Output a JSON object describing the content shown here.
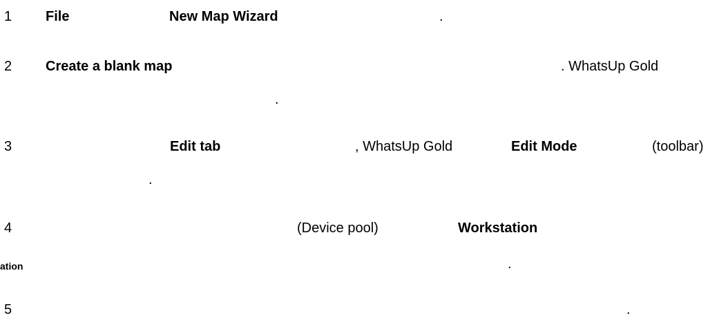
{
  "steps": [
    {
      "number": "1",
      "parts": [
        "File",
        "New Map Wizard",
        "."
      ]
    },
    {
      "number": "2",
      "parts": [
        "Create a blank map",
        ". WhatsUp Gold",
        "."
      ]
    },
    {
      "number": "3",
      "parts": [
        "Edit tab",
        ", WhatsUp Gold",
        "Edit Mode",
        "(toolbar)",
        "."
      ]
    },
    {
      "number": "4",
      "parts": [
        "(Device pool)",
        "Workstation",
        "ation",
        "."
      ]
    },
    {
      "number": "5",
      "parts": [
        "."
      ]
    }
  ]
}
